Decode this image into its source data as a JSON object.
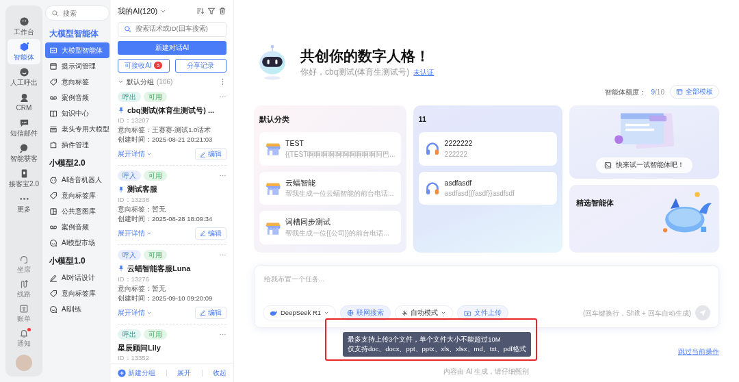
{
  "rail": {
    "items": [
      {
        "label": "工作台",
        "selected": false
      },
      {
        "label": "智能体",
        "selected": true
      },
      {
        "label": "人工呼出",
        "selected": false
      },
      {
        "label": "CRM",
        "selected": false
      },
      {
        "label": "短信邮件",
        "selected": false
      },
      {
        "label": "智能获客",
        "selected": false
      },
      {
        "label": "接客宝2.0",
        "selected": false
      },
      {
        "label": "更多",
        "selected": false
      }
    ],
    "bottom": [
      {
        "label": "坐席",
        "dot": false
      },
      {
        "label": "线路",
        "dot": false
      },
      {
        "label": "账单",
        "dot": false
      },
      {
        "label": "通知",
        "dot": true
      }
    ]
  },
  "nav": {
    "search": {
      "placeholder": "搜索"
    },
    "sections": [
      {
        "title": "大模型智能体",
        "items": [
          {
            "label": "大模型智能体",
            "selected": true
          },
          {
            "label": "提示词管理",
            "selected": false
          },
          {
            "label": "意向标签",
            "selected": false
          },
          {
            "label": "案例音频",
            "selected": false
          },
          {
            "label": "知识中心",
            "selected": false
          },
          {
            "label": "老头专用大模型",
            "selected": false
          },
          {
            "label": "插件管理",
            "selected": false
          }
        ]
      },
      {
        "title": "小模型2.0",
        "items": [
          {
            "label": "AI语音机器人",
            "selected": false
          },
          {
            "label": "意向标签库",
            "selected": false
          },
          {
            "label": "公共意图库",
            "selected": false
          },
          {
            "label": "案例音频",
            "selected": false
          },
          {
            "label": "AI模型市场",
            "selected": false
          }
        ]
      },
      {
        "title": "小模型1.0",
        "items": [
          {
            "label": "AI对话设计",
            "selected": false
          },
          {
            "label": "意向标签库",
            "selected": false
          },
          {
            "label": "AI训练",
            "selected": false
          }
        ]
      }
    ]
  },
  "list": {
    "title": "我的AI(120)",
    "search": {
      "placeholder": "搜索话术或ID(回车搜索)"
    },
    "new_button": "新建对话AI",
    "receive_button": "可接收AI",
    "receive_badge": "5",
    "share_button": "分享记录",
    "group": {
      "name": "默认分组",
      "count": "(106)",
      "expanded": true
    },
    "cards": [
      {
        "tags": [
          {
            "label": "呼出",
            "kind": "out"
          },
          {
            "label": "可用",
            "kind": "available"
          }
        ],
        "pinned": true,
        "title": "cbq测试(体育生测试号) ...",
        "id": "ID：13207",
        "intent": "意向标签：王赛赛-测试1.0话术",
        "created": "创建时间：2025-08-21 20:21:03",
        "expand": "展开详情",
        "edit": "编辑"
      },
      {
        "tags": [
          {
            "label": "呼入",
            "kind": "in"
          },
          {
            "label": "可用",
            "kind": "available"
          }
        ],
        "pinned": true,
        "title": "测试客服",
        "id": "ID：13238",
        "intent": "意向标签：暂无",
        "created": "创建时间：2025-08-28 18:09:34",
        "expand": "展开详情",
        "edit": "编辑"
      },
      {
        "tags": [
          {
            "label": "呼入",
            "kind": "in"
          },
          {
            "label": "可用",
            "kind": "available"
          }
        ],
        "pinned": true,
        "title": "云蝠智能客服Luna",
        "id": "ID：13276",
        "intent": "意向标签：暂无",
        "created": "创建时间：2025-09-10 09:20:09",
        "expand": "展开详情",
        "edit": "编辑"
      },
      {
        "tags": [
          {
            "label": "呼出",
            "kind": "out"
          },
          {
            "label": "可用",
            "kind": "available"
          }
        ],
        "pinned": false,
        "title": "星辰顾问Lily",
        "id": "ID：13352"
      }
    ],
    "footer": {
      "new_group": "新建分组",
      "expand": "展开",
      "collapse": "收起"
    }
  },
  "main": {
    "title": "共创你的数字人格！",
    "greeting": "你好，cbq测试(体育生测试号)",
    "verify_link": "未认证",
    "quota_label": "智能体额度：",
    "quota_used": "9",
    "quota_total": "/10",
    "templates_button": "全部模板",
    "categories": [
      {
        "title": "默认分类",
        "kind": "store",
        "items": [
          {
            "name": "TEST",
            "desc": "{{TEST啊啊啊啊啊啊啊啊啊啊阿巴..."
          },
          {
            "name": "云蝠智能",
            "desc": "帮我生成一位云蝠智能的前台电话..."
          },
          {
            "name": "词槽同步测试",
            "desc": "帮我生成一位{{公司}}的前台电话..."
          }
        ]
      },
      {
        "title": "11",
        "kind": "audio",
        "items": [
          {
            "name": "2222222",
            "desc": "222222"
          },
          {
            "name": "asdfasdf",
            "desc": "asdfasd{{fasdf}}asdfsdf"
          }
        ]
      }
    ],
    "try_button": "快来试一试智能体吧！",
    "featured_title": "精选智能体",
    "composer": {
      "placeholder": "给我布置一个任务...",
      "model": "DeepSeek R1",
      "web_search": {
        "label": "联网搜索",
        "selected": true
      },
      "mode": "自动模式",
      "upload": "文件上传",
      "hint": "(回车键换行，Shift + 回车自动生成)",
      "send_disabled": true
    },
    "tooltip": [
      "最多支持上传3个文件，单个文件大小不能超过10M",
      "仅支持doc、docx、ppt、pptx、xls、xlsx、md、txt、pdf格式"
    ],
    "skip_link": "跳过当前操作",
    "disclaimer": "内容由 AI 生成，请仔细甄别"
  }
}
